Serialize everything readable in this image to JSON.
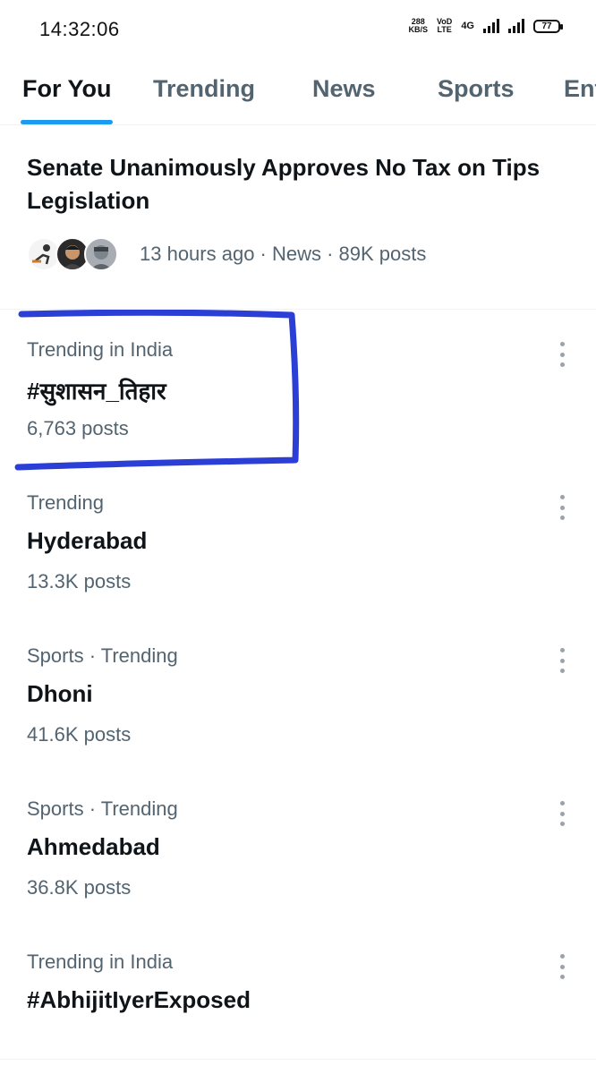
{
  "status_bar": {
    "time": "14:32:06",
    "speed_top": "288",
    "speed_unit": "KB/S",
    "volte_top": "VoD",
    "volte_bottom": "LTE",
    "network": "4G",
    "battery": "77"
  },
  "tabs": [
    {
      "label": "For You",
      "active": true
    },
    {
      "label": "Trending",
      "active": false
    },
    {
      "label": "News",
      "active": false
    },
    {
      "label": "Sports",
      "active": false
    },
    {
      "label": "Ent",
      "active": false
    }
  ],
  "headline": {
    "title": "Senate Unanimously Approves No Tax on Tips Legislation",
    "meta": "13 hours ago · News · 89K posts"
  },
  "trends": [
    {
      "context": "Trending in India",
      "name": "#सुशासन_तिहार",
      "count": "6,763 posts"
    },
    {
      "context": "Trending",
      "name": "Hyderabad",
      "count": "13.3K posts"
    },
    {
      "context": "Sports · Trending",
      "name": "Dhoni",
      "count": "41.6K posts"
    },
    {
      "context": "Sports · Trending",
      "name": "Ahmedabad",
      "count": "36.8K posts"
    },
    {
      "context": "Trending in India",
      "name": "#AbhijitIyerExposed",
      "count": ""
    }
  ],
  "colors": {
    "accent": "#1d9bf0",
    "secondary_text": "#536471",
    "primary_text": "#0f1419",
    "highlight_stroke": "#2b3fd6"
  }
}
